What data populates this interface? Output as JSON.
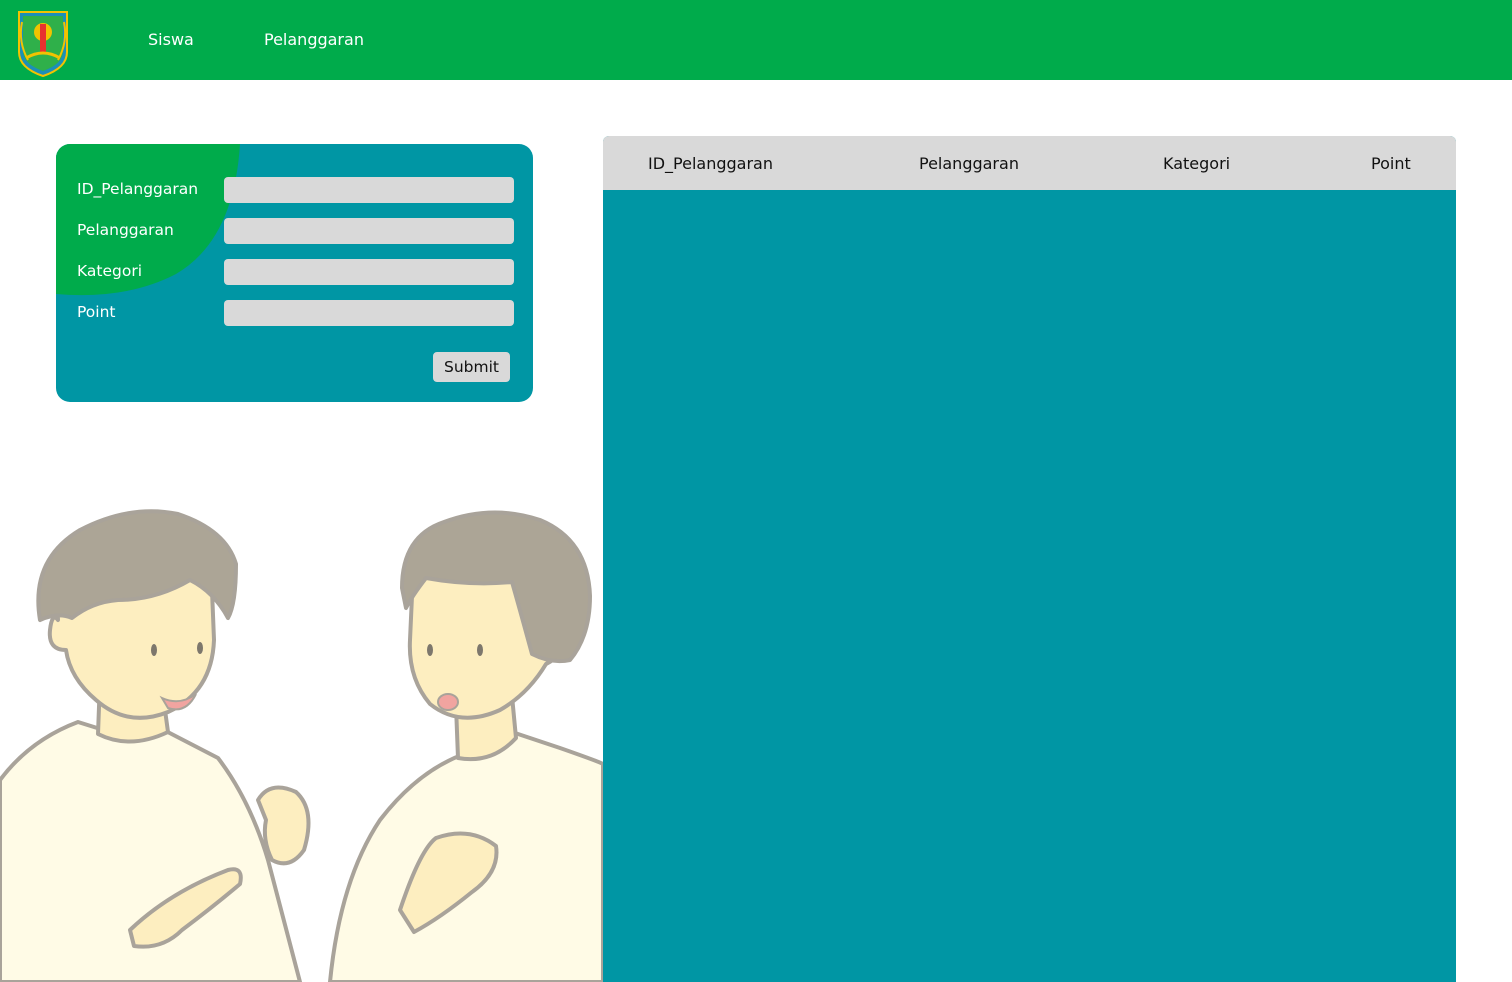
{
  "navbar": {
    "logo_icon": "regional-crest-logo",
    "links": [
      "Siswa",
      "Pelanggaran"
    ],
    "bg_color": "#00ab4b"
  },
  "form": {
    "fields": [
      {
        "label": "ID_Pelanggaran",
        "value": ""
      },
      {
        "label": "Pelanggaran",
        "value": ""
      },
      {
        "label": "Kategori",
        "value": ""
      },
      {
        "label": "Point",
        "value": ""
      }
    ],
    "submit_label": "Submit",
    "card_color": "#0096a4",
    "accent_color": "#00ab4b"
  },
  "table": {
    "columns": [
      "ID_Pelanggaran",
      "Pelanggaran",
      "Kategori",
      "Point"
    ],
    "rows": []
  },
  "illustration": {
    "icon": "two-students-talking-illustration"
  }
}
